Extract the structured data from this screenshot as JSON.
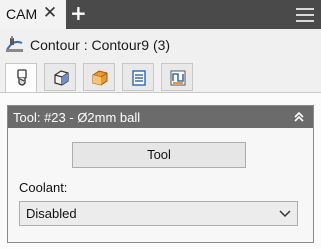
{
  "tab": {
    "label": "CAM",
    "close_glyph": "✕",
    "add_glyph": "+",
    "menu_icon": "hamburger-menu-icon"
  },
  "operation": {
    "icon": "contour-operation-icon",
    "title": "Contour : Contour9 (3)"
  },
  "property_tabs": [
    {
      "name": "tool",
      "icon": "tool-icon",
      "active": true
    },
    {
      "name": "geometry",
      "icon": "geometry-icon",
      "active": false
    },
    {
      "name": "heights",
      "icon": "heights-icon",
      "active": false
    },
    {
      "name": "passes",
      "icon": "passes-icon",
      "active": false
    },
    {
      "name": "linking",
      "icon": "linking-icon",
      "active": false
    }
  ],
  "tool_group": {
    "title": "Tool:  #23 - Ø2mm ball",
    "collapse_icon": "double-chevron-up-icon",
    "tool_button_label": "Tool",
    "coolant_label": "Coolant:",
    "coolant_value": "Disabled"
  },
  "colors": {
    "tabbar": "#4a4a4a",
    "group_header": "#6b6b6b",
    "accent_orange": "#e89a2c",
    "accent_blue": "#3b6fb6"
  }
}
